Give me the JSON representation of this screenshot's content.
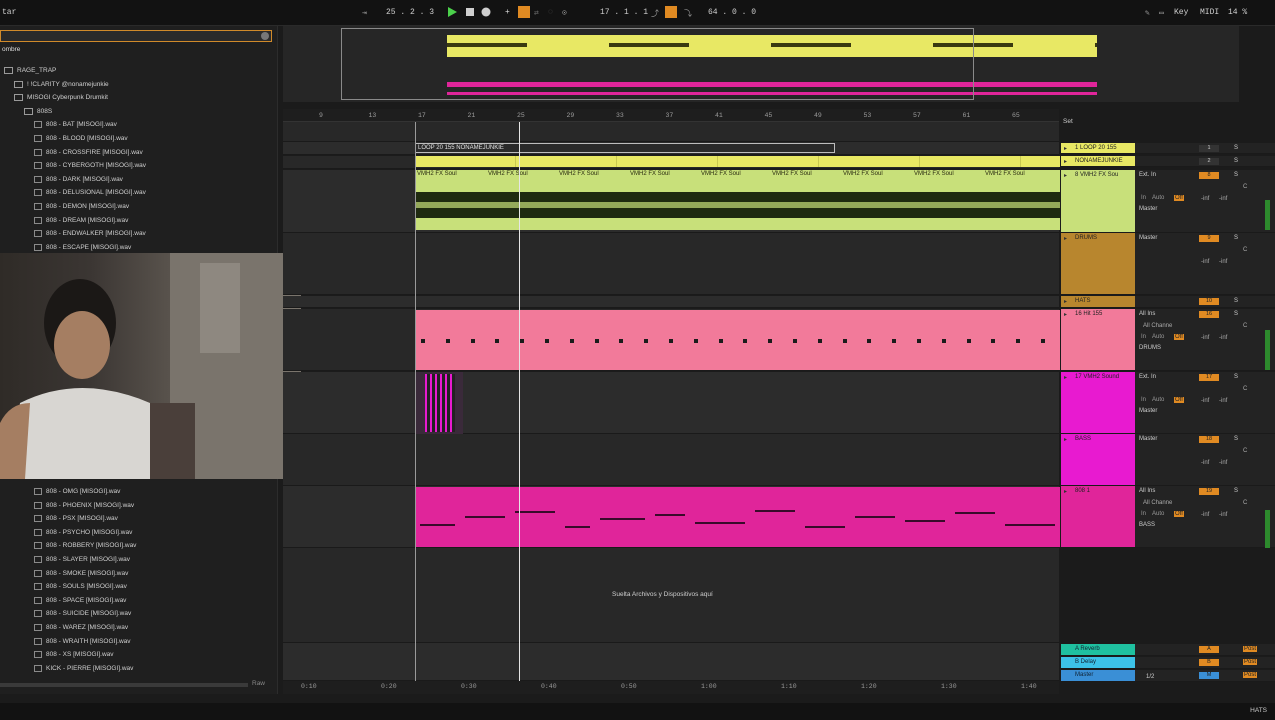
{
  "transport": {
    "arrangement_position": "25 .  2 .  3",
    "loop_start": "17 .  1 .  1",
    "loop_length": "64 .  0 .  0",
    "key_label": "Key",
    "midi_label": "MIDI",
    "cpu_label": "14 %",
    "left_label": "tar"
  },
  "browser": {
    "header": "ombre",
    "items": [
      {
        "label": "RAGE_TRAP",
        "kind": "folder",
        "indent": 0
      },
      {
        "label": "! !CLARITY @nonamejunkie",
        "kind": "folder",
        "indent": 1
      },
      {
        "label": "MISOGI Cyberpunk Drumkit",
        "kind": "folder",
        "indent": 1
      },
      {
        "label": "808S",
        "kind": "folder",
        "indent": 2
      },
      {
        "label": "808 - BAT [MISOGI].wav",
        "kind": "file",
        "indent": 3
      },
      {
        "label": "808 - BLOOD [MISOGI].wav",
        "kind": "file",
        "indent": 3
      },
      {
        "label": "808 - CROSSFIRE [MISOGI].wav",
        "kind": "file",
        "indent": 3
      },
      {
        "label": "808 - CYBERGOTH [MISOGI].wav",
        "kind": "file",
        "indent": 3
      },
      {
        "label": "808 - DARK [MISOGI].wav",
        "kind": "file",
        "indent": 3
      },
      {
        "label": "808 - DELUSIONAL [MISOGI].wav",
        "kind": "file",
        "indent": 3
      },
      {
        "label": "808 - DEMON [MISOGI].wav",
        "kind": "file",
        "indent": 3
      },
      {
        "label": "808 - DREAM [MISOGI].wav",
        "kind": "file",
        "indent": 3
      },
      {
        "label": "808 - ENDWALKER [MISOGI].wav",
        "kind": "file",
        "indent": 3
      },
      {
        "label": "808 - ESCAPE [MISOGI].wav",
        "kind": "file",
        "indent": 3
      }
    ],
    "items_lower": [
      {
        "label": "808 - OMG [MISOGI].wav"
      },
      {
        "label": "808 - PHOENIX [MISOGI].wav"
      },
      {
        "label": "808 - PSX [MISOGI].wav"
      },
      {
        "label": "808 - PSYCHO [MISOGI].wav"
      },
      {
        "label": "808 - ROBBERY [MISOGI].wav"
      },
      {
        "label": "808 - SLAYER [MISOGI].wav"
      },
      {
        "label": "808 - SMOKE [MISOGI].wav"
      },
      {
        "label": "808 - SOULS [MISOGI].wav"
      },
      {
        "label": "808 - SPACE [MISOGI].wav"
      },
      {
        "label": "808 - SUICIDE [MISOGI].wav"
      },
      {
        "label": "808 - WAREZ [MISOGI].wav"
      },
      {
        "label": "808 - WRAITH [MISOGI].wav"
      },
      {
        "label": "808 - XS [MISOGI].wav"
      },
      {
        "label": "KICK - PIERRE [MISOGI].wav"
      }
    ],
    "raw_label": "Raw"
  },
  "ruler": {
    "bars": [
      "9",
      "13",
      "17",
      "21",
      "25",
      "29",
      "33",
      "37",
      "41",
      "45",
      "49",
      "53",
      "57",
      "61",
      "65"
    ],
    "set_label": "Set"
  },
  "timeline": {
    "times": [
      "0:10",
      "0:20",
      "0:30",
      "0:40",
      "0:50",
      "1:00",
      "1:10",
      "1:20",
      "1:30",
      "1:40"
    ]
  },
  "tracks": [
    {
      "name": "1 LOOP 20 155",
      "color": "#e8e864",
      "mon": "",
      "route": ""
    },
    {
      "name": "NONAMEJUNKIE",
      "color": "#e8e864",
      "mon": "",
      "route": ""
    },
    {
      "name": "8 VMH2 FX Sou",
      "color": "#c8e07a",
      "mon": "Ext. In",
      "route": "Master"
    },
    {
      "name": "DRUMS",
      "color": "#b8862e",
      "mon": "",
      "route": "Master"
    },
    {
      "name": "HATS",
      "color": "#b8862e",
      "mon": "",
      "route": ""
    },
    {
      "name": "16 Hit 155",
      "color": "#f27a9a",
      "mon": "All Ins",
      "route": "DRUMS"
    },
    {
      "name": "17 VMH2 Sound",
      "color": "#e81ad0",
      "mon": "Ext. In",
      "route": "Master"
    },
    {
      "name": "BASS",
      "color": "#e81ad0",
      "mon": "",
      "route": "Master"
    },
    {
      "name": "808 1",
      "color": "#e0259a",
      "mon": "All Ins",
      "route": "BASS"
    }
  ],
  "clips": {
    "loop_clip_label": "LOOP 20 155 NONAMEJUNKIE",
    "audio_clip_label": "VMH2 FX Soul",
    "drop_hint": "Suelta Archivos y Dispositivos aquí"
  },
  "returns": [
    {
      "name": "A Reverb",
      "color": "#1fc1a0"
    },
    {
      "name": "B Delay",
      "color": "#3cc2e8"
    },
    {
      "name": "Master",
      "color": "#3a8fd6"
    }
  ],
  "mixer": {
    "track_numbers": [
      "1",
      "2",
      "8",
      "9",
      "10",
      "16",
      "17",
      "18",
      "19"
    ],
    "auto_label": "Auto",
    "off_label": "Off",
    "in_label": "In",
    "inf_label": "-inf",
    "c_label": "C",
    "s_label": "S",
    "all_channels_label": "All Channe",
    "return_labels": [
      "A",
      "B",
      "M"
    ],
    "post_label": "Post",
    "master_value": "1/2"
  },
  "status": {
    "right_label": "HATS"
  },
  "colors": {
    "accent": "#e08a22",
    "yellow_clip": "#e8e864",
    "green_clip": "#c8e07a",
    "pink_clip": "#f27a9a",
    "magenta_clip": "#e0259a"
  }
}
